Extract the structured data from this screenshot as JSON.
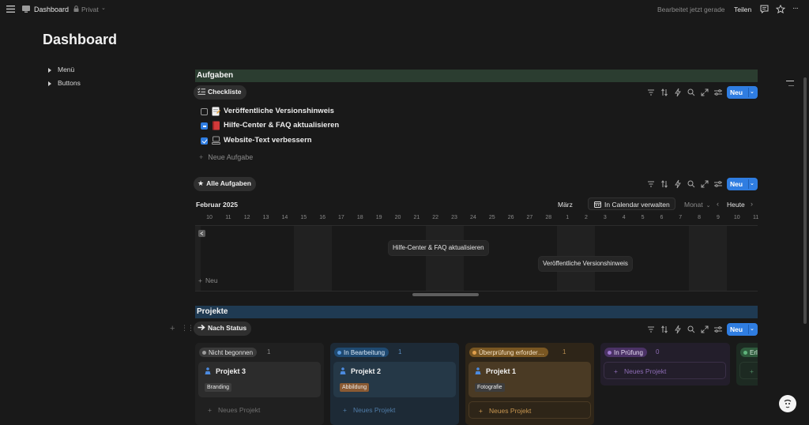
{
  "topbar": {
    "breadcrumb_title": "Dashboard",
    "privacy": "Privat",
    "edited": "Bearbeitet jetzt gerade",
    "share": "Teilen",
    "more": "···"
  },
  "page": {
    "title": "Dashboard",
    "toggles": [
      "Menü",
      "Buttons"
    ]
  },
  "tasks_section": {
    "title": "Aufgaben",
    "view_chip": "Checkliste",
    "new_button": "Neu",
    "items": [
      {
        "label": "Veröffentliche Versionshinweis",
        "state": "unchecked",
        "icon": "memo-icon"
      },
      {
        "label": "Hilfe-Center & FAQ aktualisieren",
        "state": "partial",
        "icon": "book-icon"
      },
      {
        "label": "Website-Text verbessern",
        "state": "checked",
        "icon": "computer-icon"
      }
    ],
    "new_task": "Neue Aufgabe"
  },
  "calendar": {
    "view_chip": "Alle Aufgaben",
    "new_button": "Neu",
    "month_left": "Februar 2025",
    "month_right": "März",
    "manage_button": "In Calendar verwalten",
    "range_select": "Monat",
    "today": "Heute",
    "days": [
      "10",
      "11",
      "12",
      "13",
      "14",
      "15",
      "16",
      "17",
      "18",
      "19",
      "20",
      "21",
      "22",
      "23",
      "24",
      "25",
      "26",
      "27",
      "28",
      "1",
      "2",
      "3",
      "4",
      "5",
      "6",
      "7",
      "8",
      "9",
      "10",
      "11"
    ],
    "events": [
      "Hilfe-Center & FAQ aktualisieren",
      "Veröffentliche Versionshinweis"
    ],
    "add_label": "Neu"
  },
  "projects": {
    "title": "Projekte",
    "view_chip": "Nach Status",
    "new_button": "Neu",
    "new_project": "Neues Projekt",
    "columns": [
      {
        "status": "Nicht begonnen",
        "count": "1",
        "card": {
          "title": "Projekt 3",
          "tag": "Branding"
        }
      },
      {
        "status": "In Bearbeitung",
        "count": "1",
        "card": {
          "title": "Projekt 2",
          "tag": "Abbildung"
        }
      },
      {
        "status": "Überprüfung erforder…",
        "count": "1",
        "card": {
          "title": "Projekt 1",
          "tag": "Fotografie"
        }
      },
      {
        "status": "In Prüfung",
        "count": "0"
      },
      {
        "status": "Erl"
      }
    ]
  },
  "colors": {
    "accent": "#2f7de1",
    "tasks_header": "#2b3d30",
    "projects_header": "#1f3a52"
  }
}
